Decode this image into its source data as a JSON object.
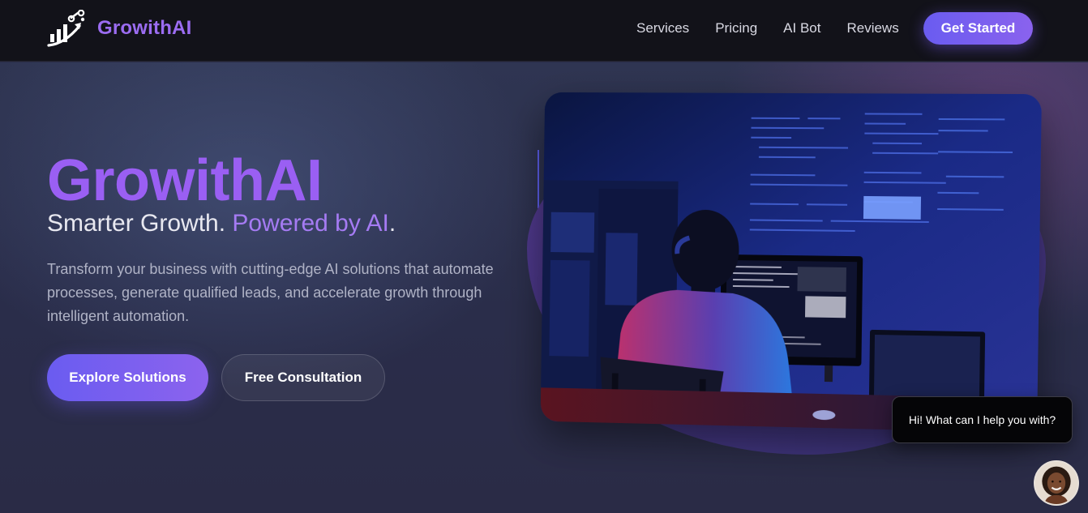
{
  "brand": {
    "name": "GrowithAI",
    "logo_icon": "growth-chart-icon"
  },
  "nav": {
    "items": [
      {
        "label": "Services"
      },
      {
        "label": "Pricing"
      },
      {
        "label": "AI Bot"
      },
      {
        "label": "Reviews"
      }
    ],
    "cta_label": "Get Started"
  },
  "hero": {
    "title": "GrowithAI",
    "subtitle_plain": "Smarter Growth.",
    "subtitle_accent": "Powered by AI",
    "subtitle_end": ".",
    "description": "Transform your business with cutting-edge AI solutions that automate processes, generate qualified leads, and accelerate growth through intelligent automation.",
    "primary_button": "Explore Solutions",
    "secondary_button": "Free Consultation"
  },
  "chat": {
    "message": "Hi! What can I help you with?",
    "avatar_icon": "assistant-avatar"
  },
  "colors": {
    "brand_purple": "#9a5ff3",
    "accent_purple": "#a57bf3",
    "button_gradient_start": "#6a5cf0",
    "header_bg": "#121219",
    "hero_bg": "#2a2d48"
  }
}
